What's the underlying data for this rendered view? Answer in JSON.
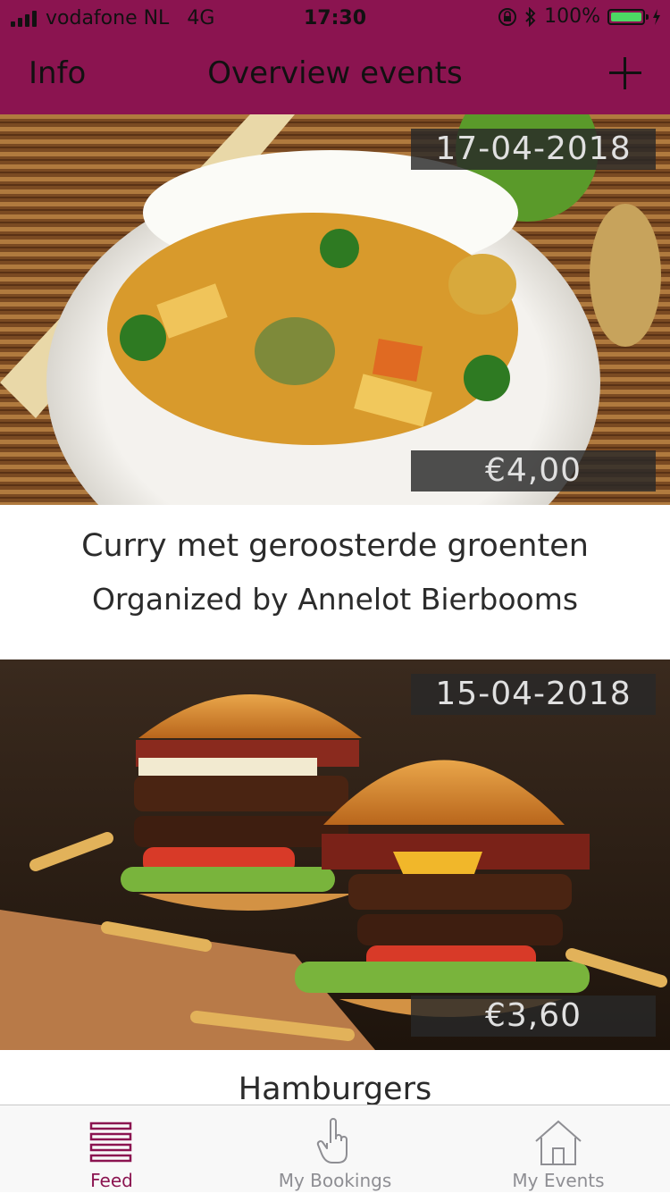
{
  "status": {
    "carrier": "vodafone NL",
    "network": "4G",
    "time": "17:30",
    "battery": "100%",
    "battery_level": 1.0
  },
  "nav": {
    "left": "Info",
    "title": "Overview events",
    "right_icon": "plus-icon"
  },
  "events": [
    {
      "date": "17-04-2018",
      "price": "€4,00",
      "title": "Curry met geroosterde groenten",
      "organizer": "Organized by Annelot Bierbooms"
    },
    {
      "date": "15-04-2018",
      "price": "€3,60",
      "title": "Hamburgers"
    }
  ],
  "tabs": [
    {
      "label": "Feed",
      "icon": "list-icon",
      "active": true
    },
    {
      "label": "My Bookings",
      "icon": "hand-pointer-icon",
      "active": false
    },
    {
      "label": "My Events",
      "icon": "home-icon",
      "active": false
    }
  ],
  "colors": {
    "brand": "#8b1450",
    "tab_inactive": "#8e8e93",
    "battery": "#4cd964"
  }
}
